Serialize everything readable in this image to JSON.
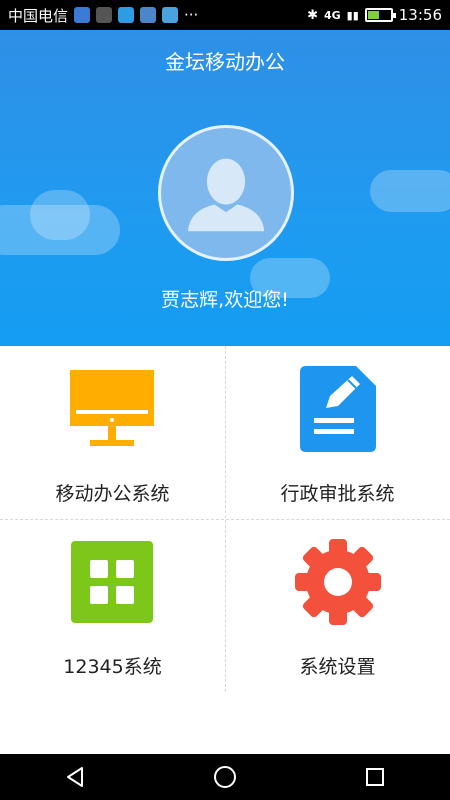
{
  "status_bar": {
    "carrier": "中国电信",
    "network": "4G",
    "time": "13:56",
    "battery_level": 0.45
  },
  "header": {
    "title": "金坛移动办公",
    "welcome": "贾志辉,欢迎您!"
  },
  "menu": {
    "items": [
      {
        "label": "移动办公系统",
        "icon": "monitor-icon",
        "color": "#FFAD00"
      },
      {
        "label": "行政审批系统",
        "icon": "document-edit-icon",
        "color": "#1E96F0"
      },
      {
        "label": "12345系统",
        "icon": "grid-apps-icon",
        "color": "#7DC71A"
      },
      {
        "label": "系统设置",
        "icon": "gear-icon",
        "color": "#F4513D"
      }
    ]
  },
  "colors": {
    "header_top": "#2f8fe6",
    "header_bottom": "#139df2"
  }
}
